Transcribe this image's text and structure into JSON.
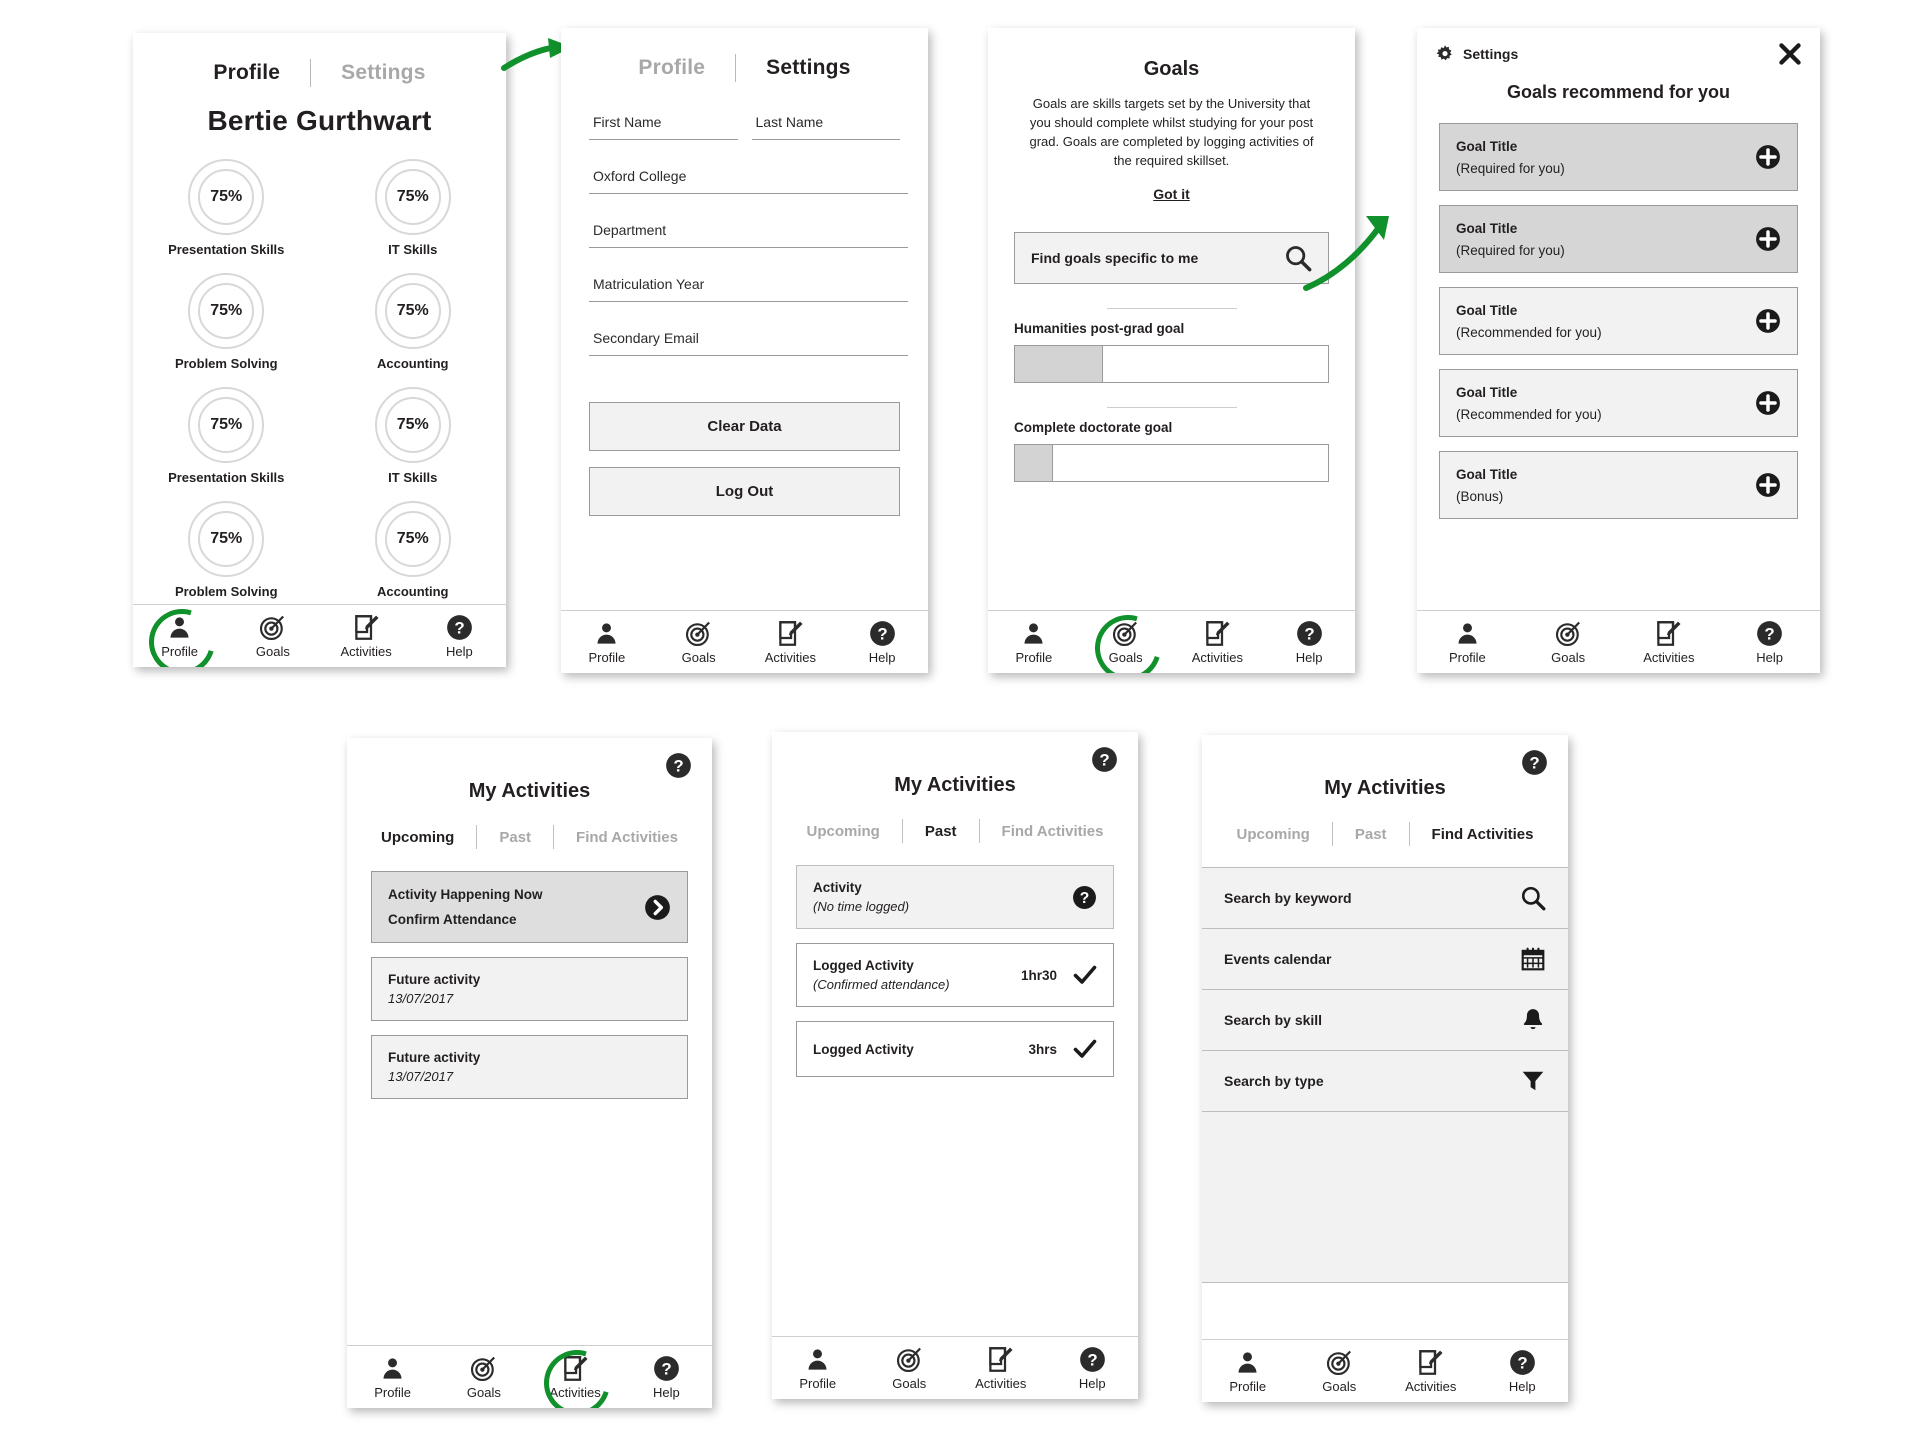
{
  "accent_green": "#11912b",
  "nav": {
    "items": [
      {
        "label": "Profile",
        "icon": "person-icon"
      },
      {
        "label": "Goals",
        "icon": "target-icon"
      },
      {
        "label": "Activities",
        "icon": "note-pencil-icon"
      },
      {
        "label": "Help",
        "icon": "question-circle-icon"
      }
    ]
  },
  "profile_screen": {
    "tabs": {
      "profile": "Profile",
      "settings": "Settings"
    },
    "user_name": "Bertie Gurthwart",
    "skills": [
      {
        "label": "Presentation Skills",
        "value": "75%"
      },
      {
        "label": "IT Skills",
        "value": "75%"
      },
      {
        "label": "Problem Solving",
        "value": "75%"
      },
      {
        "label": "Accounting",
        "value": "75%"
      },
      {
        "label": "Presentation Skills",
        "value": "75%"
      },
      {
        "label": "IT Skills",
        "value": "75%"
      },
      {
        "label": "Problem Solving",
        "value": "75%"
      },
      {
        "label": "Accounting",
        "value": "75%"
      }
    ],
    "highlighted_nav": "Profile"
  },
  "settings_screen": {
    "tabs": {
      "profile": "Profile",
      "settings": "Settings"
    },
    "fields": [
      {
        "label": "First Name"
      },
      {
        "label": "Last Name"
      },
      {
        "label": "Oxford College"
      },
      {
        "label": "Department"
      },
      {
        "label": "Matriculation Year"
      },
      {
        "label": "Secondary Email"
      }
    ],
    "clear_data_label": "Clear Data",
    "log_out_label": "Log Out"
  },
  "goals_screen": {
    "title": "Goals",
    "description": "Goals are skills targets set by the University that you should complete whilst studying for your post grad. Goals are completed by logging activities of the required skillset.",
    "got_it_label": "Got it",
    "search_label": "Find goals specific to me",
    "search_icon": "search-icon",
    "goals": [
      {
        "label": "Humanities post-grad goal",
        "progress": 33
      },
      {
        "label": "Complete doctorate goal",
        "progress": 13
      }
    ],
    "highlighted_nav": "Goals"
  },
  "recommend_screen": {
    "settings_label": "Settings",
    "settings_icon": "gear-icon",
    "close_icon": "close-icon",
    "title": "Goals recommend for you",
    "items": [
      {
        "title": "Goal Title",
        "subtitle": "(Required for you)",
        "shade": "dark",
        "add_icon": "plus-circle-icon"
      },
      {
        "title": "Goal Title",
        "subtitle": "(Required for you)",
        "shade": "dark",
        "add_icon": "plus-circle-icon"
      },
      {
        "title": "Goal Title",
        "subtitle": "(Recommended for you)",
        "shade": "light",
        "add_icon": "plus-circle-icon"
      },
      {
        "title": "Goal Title",
        "subtitle": "(Recommended for you)",
        "shade": "light",
        "add_icon": "plus-circle-icon"
      },
      {
        "title": "Goal Title",
        "subtitle": "(Bonus)",
        "shade": "light",
        "add_icon": "plus-circle-icon"
      }
    ]
  },
  "activities_upcoming": {
    "help_icon": "question-circle-icon",
    "title": "My Activities",
    "tabs": [
      {
        "label": "Upcoming",
        "active": true
      },
      {
        "label": "Past",
        "active": false
      },
      {
        "label": "Find Activities",
        "active": false
      }
    ],
    "cards": [
      {
        "line1": "Activity Happening Now",
        "line2": "Confirm Attendance",
        "icon": "chevron-right-circle-icon",
        "shade": "grey"
      },
      {
        "line1": "Future activity",
        "date": "13/07/2017",
        "shade": "lgrey"
      },
      {
        "line1": "Future activity",
        "date": "13/07/2017",
        "shade": "lgrey"
      }
    ],
    "highlighted_nav": "Activities"
  },
  "activities_past": {
    "help_icon": "question-circle-icon",
    "title": "My Activities",
    "tabs": [
      {
        "label": "Upcoming",
        "active": false
      },
      {
        "label": "Past",
        "active": true
      },
      {
        "label": "Find Activities",
        "active": false
      }
    ],
    "cards": [
      {
        "line1": "Activity",
        "sub": "(No time logged)",
        "duration": "",
        "icon": "question-circle-icon",
        "shade": "lgrey"
      },
      {
        "line1": "Logged Activity",
        "sub": "(Confirmed attendance)",
        "duration": "1hr30",
        "icon": "check-icon",
        "shade": "white"
      },
      {
        "line1": "Logged Activity",
        "sub": "",
        "duration": "3hrs",
        "icon": "check-icon",
        "shade": "white"
      }
    ]
  },
  "activities_find": {
    "help_icon": "question-circle-icon",
    "title": "My Activities",
    "tabs": [
      {
        "label": "Upcoming",
        "active": false
      },
      {
        "label": "Past",
        "active": false
      },
      {
        "label": "Find Activities",
        "active": true
      }
    ],
    "rows": [
      {
        "label": "Search by keyword",
        "icon": "search-icon"
      },
      {
        "label": "Events calendar",
        "icon": "calendar-icon"
      },
      {
        "label": "Search by skill",
        "icon": "bell-icon"
      },
      {
        "label": "Search by type",
        "icon": "funnel-icon"
      }
    ]
  }
}
